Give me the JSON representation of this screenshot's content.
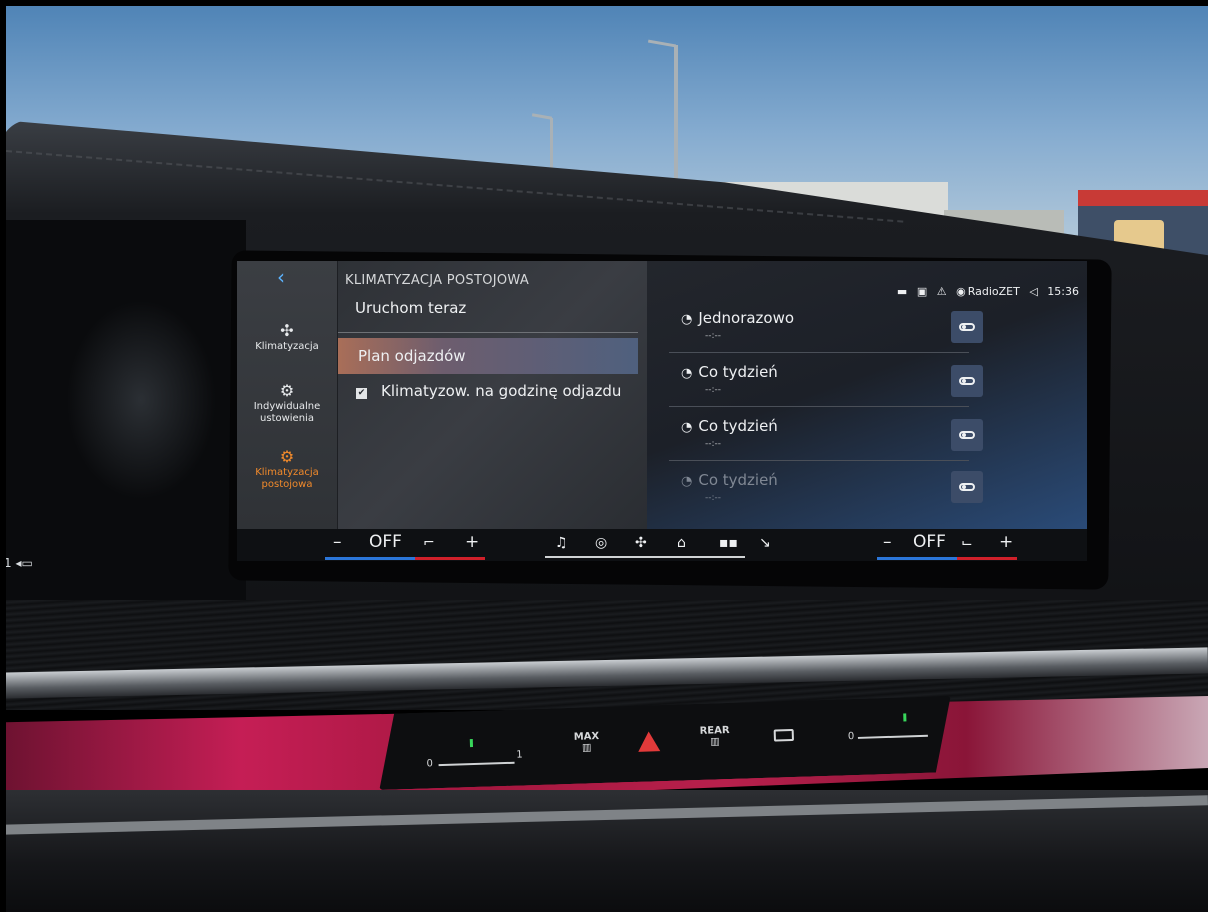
{
  "screen": {
    "back_label": "‹",
    "sidebar": {
      "items": [
        {
          "icon": "fan-icon",
          "glyph": "✣",
          "label": "Klimatyzacja",
          "active": false
        },
        {
          "icon": "gear-person-icon",
          "glyph": "⚙",
          "label": "Indywidualne ustowienia",
          "active": false
        },
        {
          "icon": "gear-icon",
          "glyph": "⚙",
          "label": "Klimatyzacja postojowa",
          "active": true
        }
      ]
    },
    "menu": {
      "title": "KLIMATYZACJA POSTOJOWA",
      "start_now": "Uruchom teraz",
      "departure_plan": "Plan odjazdów",
      "checkbox_label": "Klimatyzow. na godzinę odjazdu",
      "checkbox_checked": true
    },
    "status": {
      "icons": [
        "▬",
        "▣",
        "⚠"
      ],
      "radio_icon": "radio-icon",
      "radio": "RadioZET",
      "volume_icon": "speaker-icon",
      "time": "15:36"
    },
    "schedules": [
      {
        "label": "Jednorazowo",
        "time": "--:--",
        "enabled": true,
        "dim": false
      },
      {
        "label": "Co tydzień",
        "time": "--:--",
        "enabled": true,
        "dim": false
      },
      {
        "label": "Co tydzień",
        "time": "--:--",
        "enabled": true,
        "dim": false
      },
      {
        "label": "Co tydzień",
        "time": "--:--",
        "enabled": true,
        "dim": true
      }
    ],
    "bottom_bar": {
      "left_minus": "–",
      "left_status": "OFF",
      "left_plus": "+",
      "right_minus": "–",
      "right_status": "OFF",
      "right_plus": "+",
      "nav_icons": [
        "music-icon",
        "navigation-icon",
        "fan-icon",
        "home-icon",
        "apps-icon",
        "phone-icon"
      ]
    }
  },
  "console": {
    "max_label": "MAX",
    "rear_label": "REAR",
    "slider_left_min": "0",
    "slider_left_max": "1",
    "slider_right_min": "0",
    "slider_right_max": "1"
  },
  "colors": {
    "accent_orange": "#f18a2b",
    "back_blue": "#5cb4ff",
    "temp_blue": "#2b76d9",
    "temp_red": "#d0202a"
  }
}
